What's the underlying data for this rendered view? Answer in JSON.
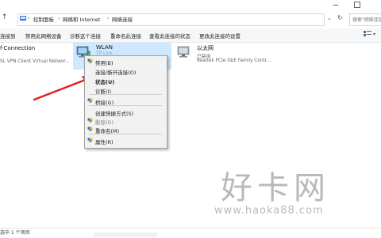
{
  "breadcrumb": {
    "items": [
      "控制面板",
      "网络和 Internet",
      "网络连接"
    ]
  },
  "search": {
    "placeholder": "搜索\"网络连接\""
  },
  "toolbar": {
    "items": [
      "连接到",
      "禁用此网络设备",
      "诊断这个连接",
      "重命名此连接",
      "查看此连接的状态",
      "更改此连接的设置"
    ]
  },
  "adapters": [
    {
      "name": "f-Connection",
      "line1": "",
      "line2": "SL VPN Client Virtual Networ..."
    },
    {
      "name": "WLAN",
      "line1": "TP-Link",
      "line2": ""
    },
    {
      "name": "以太网",
      "line1": "已禁用",
      "line2": "Realtek PCIe GbE Family Contr..."
    }
  ],
  "context_menu": {
    "items": [
      {
        "label": "禁用(B)"
      },
      {
        "label": "连接/断开连接(O)"
      },
      {
        "label": "状态(U)"
      },
      {
        "label": "诊断(I)"
      },
      {
        "label": "桥接(G)"
      },
      {
        "label": "创建快捷方式(S)"
      },
      {
        "label": "删除(D)"
      },
      {
        "label": "重命名(M)"
      },
      {
        "label": "属性(R)"
      }
    ]
  },
  "statusbar": {
    "text": "选中 1 个项目"
  },
  "watermark": {
    "big": "好卡网",
    "url": "www.haoka88.com"
  },
  "colors": {
    "arrow": "#e02020",
    "selection": "#cde8ff",
    "shield_blue": "#2b6fd1",
    "shield_yellow": "#f3c21b"
  }
}
